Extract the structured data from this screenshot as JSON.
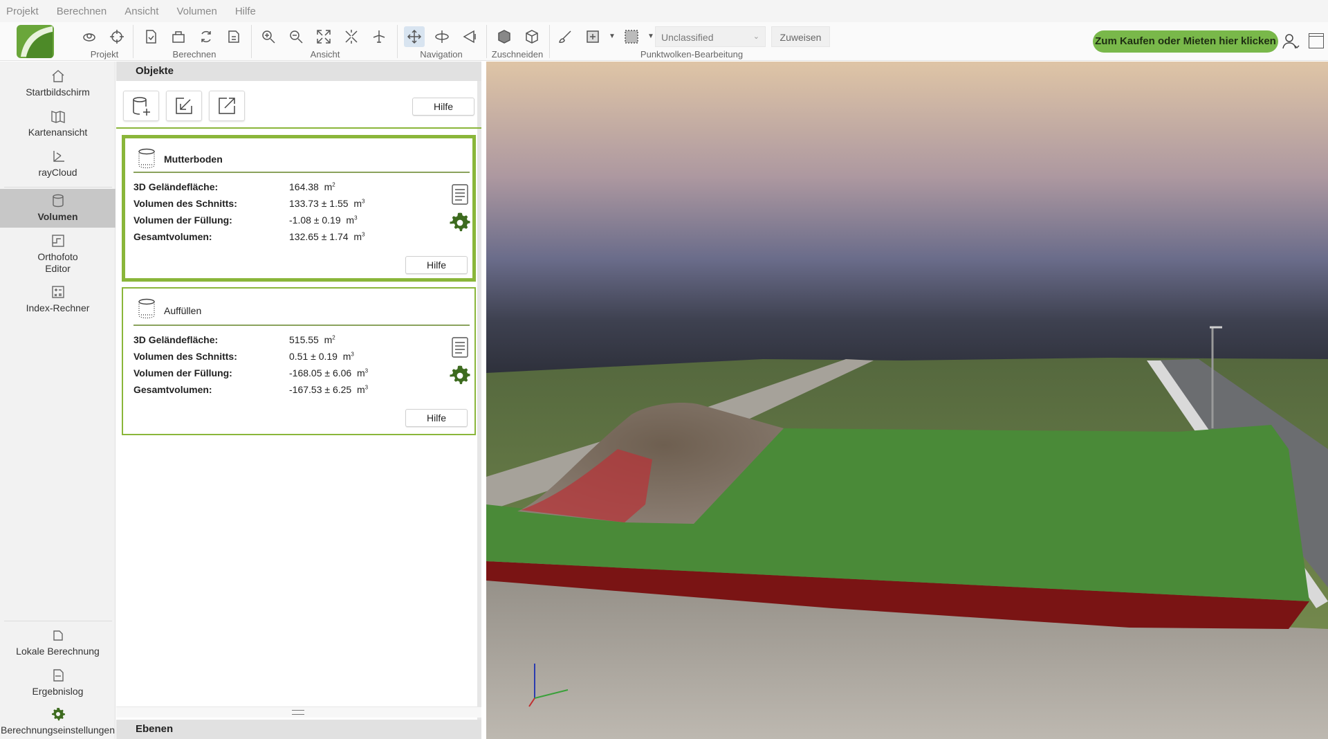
{
  "menu": [
    "Projekt",
    "Berechnen",
    "Ansicht",
    "Volumen",
    "Hilfe"
  ],
  "toolbar": {
    "groups": [
      "Projekt",
      "Berechnen",
      "Ansicht",
      "Navigation",
      "Zuschneiden",
      "Punktwolken-Bearbeitung"
    ],
    "classification_value": "Unclassified",
    "assign_label": "Zuweisen",
    "buy_label": "Zum Kaufen oder Mieten hier klicken"
  },
  "sidebar": {
    "top_items": [
      {
        "label": "Startbildschirm",
        "icon": "home-icon"
      },
      {
        "label": "Kartenansicht",
        "icon": "map-icon"
      },
      {
        "label": "rayCloud",
        "icon": "raycloud-icon"
      },
      {
        "label": "Volumen",
        "icon": "volume-icon",
        "active": true
      },
      {
        "label": "Orthofoto Editor",
        "icon": "orthophoto-icon"
      },
      {
        "label": "Index-Rechner",
        "icon": "calculator-icon"
      }
    ],
    "bottom_items": [
      {
        "label": "Lokale Berechnung",
        "icon": "local-processing-icon"
      },
      {
        "label": "Ergebnislog",
        "icon": "log-icon"
      },
      {
        "label": "Berechnungseinstellungen",
        "icon": "gear-icon"
      }
    ]
  },
  "panel": {
    "objects_title": "Objekte",
    "help_label": "Hilfe",
    "volumes": [
      {
        "name": "Mutterboden",
        "selected": true,
        "rows": [
          {
            "label": "3D Geländefläche:",
            "value": "164.38",
            "unit": "m",
            "exp": "2"
          },
          {
            "label": "Volumen des Schnitts:",
            "value": "133.73  ± 1.55",
            "unit": "m",
            "exp": "3"
          },
          {
            "label": "Volumen der Füllung:",
            "value": "-1.08  ± 0.19",
            "unit": "m",
            "exp": "3"
          },
          {
            "label": "Gesamtvolumen:",
            "value": "132.65  ± 1.74",
            "unit": "m",
            "exp": "3"
          }
        ]
      },
      {
        "name": "Auffüllen",
        "selected": false,
        "rows": [
          {
            "label": "3D Geländefläche:",
            "value": "515.55",
            "unit": "m",
            "exp": "2"
          },
          {
            "label": "Volumen des Schnitts:",
            "value": "0.51  ± 0.19",
            "unit": "m",
            "exp": "3"
          },
          {
            "label": "Volumen der Füllung:",
            "value": "-168.05  ± 6.06",
            "unit": "m",
            "exp": "3"
          },
          {
            "label": "Gesamtvolumen:",
            "value": "-167.53  ± 6.25",
            "unit": "m",
            "exp": "3"
          }
        ]
      }
    ],
    "layers_title": "Ebenen"
  },
  "colors": {
    "accent": "#79b84a",
    "card_border": "#8ab63a",
    "fill_red": "#7a1414",
    "surface_green": "#4a8a38"
  }
}
